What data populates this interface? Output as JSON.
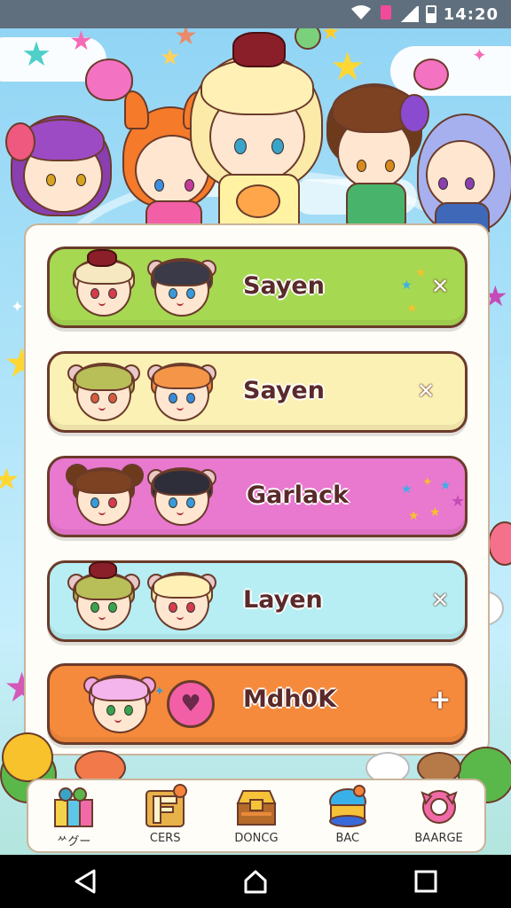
{
  "status_bar": {
    "time": "14:20"
  },
  "list": {
    "rows": [
      {
        "label": "Sayen",
        "color": "#a6d852",
        "action_icon": "close-icon",
        "action_glyph": "✕"
      },
      {
        "label": "Sayen",
        "color": "#fbf1b4",
        "action_icon": "close-icon",
        "action_glyph": "✕"
      },
      {
        "label": "Garlack",
        "color": "#e978cf",
        "action_icon": "sparkle-icon",
        "action_glyph": ""
      },
      {
        "label": "Layen",
        "color": "#b6eef4",
        "action_icon": "close-icon",
        "action_glyph": "✕"
      },
      {
        "label": "Mdh0K",
        "color": "#f58a3c",
        "action_icon": "plus-icon",
        "action_glyph": "+"
      }
    ]
  },
  "tabbar": {
    "tabs": [
      {
        "label": "ᄽグー",
        "icon": "gift-icon"
      },
      {
        "label": "CERS",
        "icon": "letter-block-icon"
      },
      {
        "label": "DONCG",
        "icon": "treasure-chest-icon"
      },
      {
        "label": "BAC",
        "icon": "cake-icon"
      },
      {
        "label": "BAARGE",
        "icon": "ribbon-badge-icon"
      }
    ]
  },
  "nav": {
    "back_icon": "back-triangle-icon",
    "home_icon": "home-icon",
    "recents_icon": "recents-square-icon"
  },
  "colors": {
    "background": "#a9e1f8",
    "panel": "#fffdf8",
    "outline": "#6b3b2a"
  }
}
